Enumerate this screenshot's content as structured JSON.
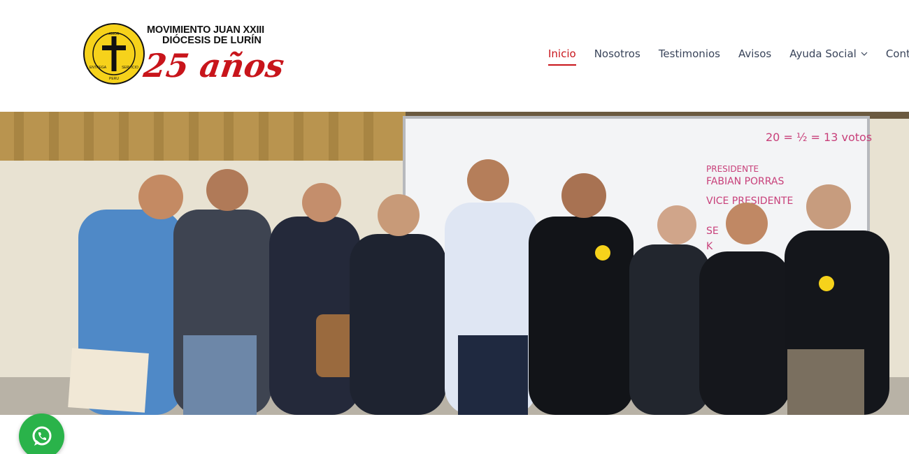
{
  "logo": {
    "org_line1": "MOVIMIENTO JUAN XXIII",
    "org_line2": "DIÓCESIS DE LURÍN",
    "anniversary": "25 años",
    "seal_ring_text": "MOVIMIENTO DE RETIROS PARROQUIALES JUAN XXIII",
    "seal_words": [
      "AMOR",
      "ENTREGA",
      "SERVICIO",
      "PERU"
    ]
  },
  "nav": {
    "items": [
      {
        "label": "Inicio",
        "active": true
      },
      {
        "label": "Nosotros",
        "active": false
      },
      {
        "label": "Testimonios",
        "active": false
      },
      {
        "label": "Avisos",
        "active": false
      },
      {
        "label": "Ayuda Social",
        "active": false,
        "has_dropdown": true
      },
      {
        "label": "Conta",
        "active": false
      }
    ]
  },
  "hero": {
    "description": "Group photo",
    "whiteboard_text": [
      "20 = ½ = 13 votos",
      "PRESIDENTE",
      "FABIAN PORRAS",
      "VICE PRESIDENTE",
      "SE",
      "K"
    ]
  },
  "colors": {
    "accent": "#c8151b",
    "nav_text": "#39445a",
    "whatsapp": "#2ab34a",
    "seal_yellow": "#f6d21b"
  },
  "icons": {
    "whatsapp": "whatsapp-icon",
    "dropdown": "chevron-down-icon",
    "logo_seal": "cross-seal-icon"
  }
}
